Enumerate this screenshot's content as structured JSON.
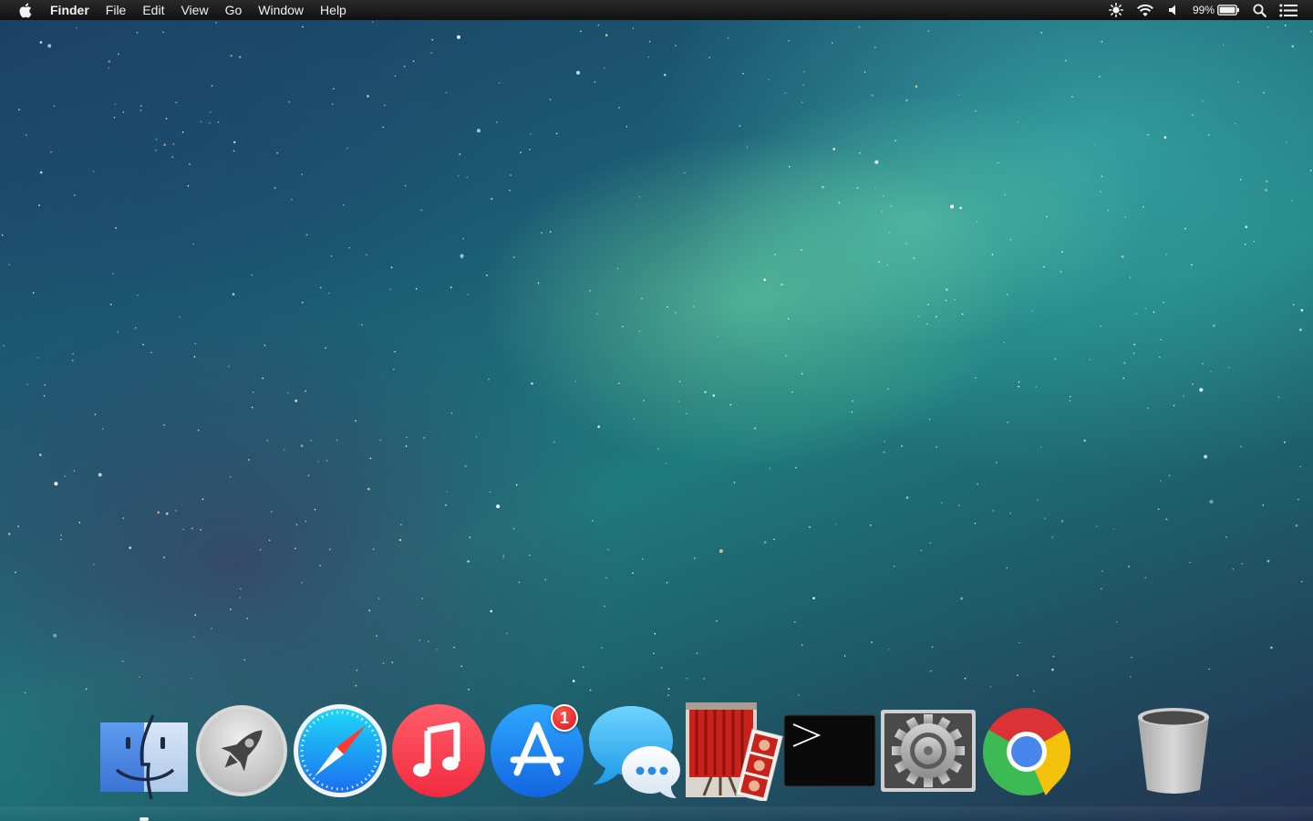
{
  "menubar": {
    "app_name": "Finder",
    "menus": [
      "File",
      "Edit",
      "View",
      "Go",
      "Window",
      "Help"
    ],
    "status": {
      "battery_percent": "99%",
      "icons": [
        "brightness-icon",
        "wifi-icon",
        "volume-icon",
        "battery-icon",
        "spotlight-icon",
        "notification-center-icon"
      ]
    }
  },
  "dock": {
    "items": [
      {
        "name": "Finder",
        "icon": "finder-icon",
        "running": true
      },
      {
        "name": "Launchpad",
        "icon": "rocket-icon",
        "running": false
      },
      {
        "name": "Safari",
        "icon": "compass-icon",
        "running": false
      },
      {
        "name": "iTunes",
        "icon": "music-note-icon",
        "running": false
      },
      {
        "name": "App Store",
        "icon": "app-store-icon",
        "running": false,
        "badge": "1"
      },
      {
        "name": "Messages",
        "icon": "chat-bubbles-icon",
        "running": false
      },
      {
        "name": "Photo Booth",
        "icon": "photo-booth-icon",
        "running": false
      },
      {
        "name": "Terminal",
        "icon": "terminal-icon",
        "running": false
      },
      {
        "name": "System Preferences",
        "icon": "gear-icon",
        "running": false
      },
      {
        "name": "Google Chrome",
        "icon": "chrome-icon",
        "running": false
      },
      {
        "name": "Trash",
        "icon": "trash-icon",
        "running": false
      }
    ]
  },
  "colors": {
    "menubar_bg": "#1a1a1a",
    "badge_red": "#e0141a",
    "itunes_red": "#fc3c44",
    "app_store_blue": "#1a8cf0",
    "finder_blue": "#4a8fe8"
  }
}
